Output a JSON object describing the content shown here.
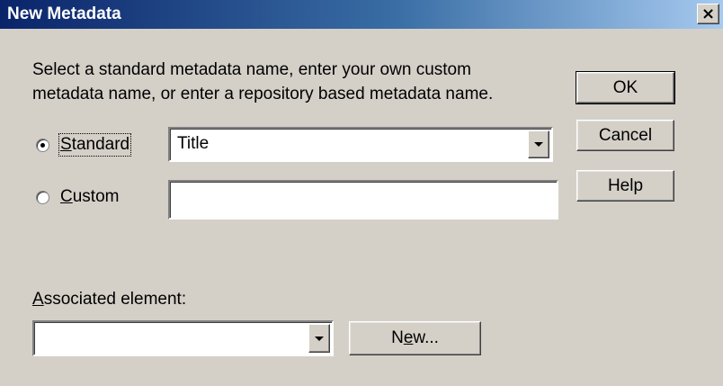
{
  "window": {
    "title": "New Metadata",
    "close_glyph": "×"
  },
  "instructions": {
    "line1": "Select a standard metadata name, enter your own custom",
    "line2": "metadata name, or enter a repository based metadata name."
  },
  "buttons": {
    "ok": "OK",
    "cancel": "Cancel",
    "help": "Help",
    "new_prefix": "N",
    "new_accel": "e",
    "new_suffix": "w..."
  },
  "standard": {
    "label_accel": "S",
    "label_rest": "tandard",
    "selected": true,
    "value": "Title"
  },
  "custom": {
    "label_accel": "C",
    "label_rest": "ustom",
    "selected": false,
    "value": ""
  },
  "associated": {
    "label_accel": "A",
    "label_rest": "ssociated element:",
    "value": ""
  },
  "icons": {
    "close": "close-icon",
    "dropdown": "chevron-down-icon"
  }
}
